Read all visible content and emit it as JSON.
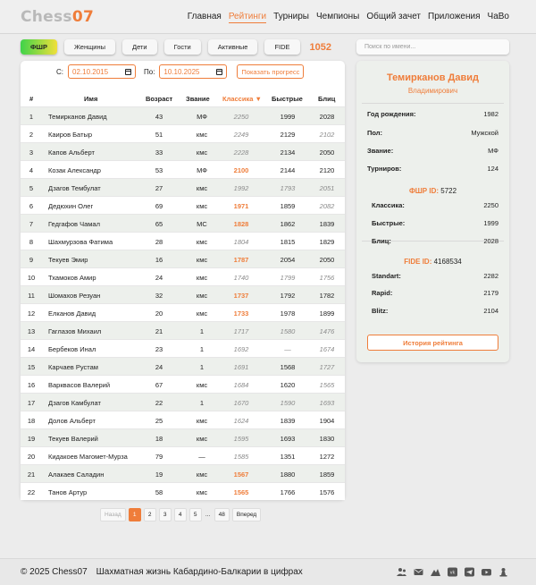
{
  "logo": {
    "part1": "Chess",
    "part2": "07"
  },
  "nav": [
    "Главная",
    "Рейтинги",
    "Турниры",
    "Чемпионы",
    "Общий зачет",
    "Приложения",
    "ЧаВо"
  ],
  "nav_active": 1,
  "filters": [
    "ФШР",
    "Женщины",
    "Дети",
    "Гости",
    "Активные",
    "FIDE"
  ],
  "filter_active": 0,
  "count": "1052",
  "search": {
    "placeholder": "Поиск по имени..."
  },
  "date_from_label": "С:",
  "date_from": "02.10.2015",
  "date_to_label": "По:",
  "date_to": "10.10.2025",
  "progress_label": "Показать прогресс",
  "columns": {
    "no": "#",
    "name": "Имя",
    "age": "Возраст",
    "title": "Звание",
    "classic": "Классика ▼",
    "blitz": "Быстрые",
    "bullet": "Блиц"
  },
  "rows": [
    {
      "no": "1",
      "name": "Темирканов Давид",
      "age": "43",
      "title": "МФ",
      "classic": "2250",
      "classic_style": "gray",
      "rapid": "1999",
      "rapid_style": "normal",
      "blitz": "2028",
      "blitz_style": "normal"
    },
    {
      "no": "2",
      "name": "Каиров Батыр",
      "age": "51",
      "title": "кмс",
      "classic": "2249",
      "classic_style": "gray",
      "rapid": "2129",
      "rapid_style": "normal",
      "blitz": "2102",
      "blitz_style": "gray"
    },
    {
      "no": "3",
      "name": "Капов Альберт",
      "age": "33",
      "title": "кмс",
      "classic": "2228",
      "classic_style": "gray",
      "rapid": "2134",
      "rapid_style": "normal",
      "blitz": "2050",
      "blitz_style": "normal"
    },
    {
      "no": "4",
      "name": "Козак Александр",
      "age": "53",
      "title": "МФ",
      "classic": "2100",
      "classic_style": "orange",
      "rapid": "2144",
      "rapid_style": "normal",
      "blitz": "2120",
      "blitz_style": "normal"
    },
    {
      "no": "5",
      "name": "Дзагов Тембулат",
      "age": "27",
      "title": "кмс",
      "classic": "1992",
      "classic_style": "gray",
      "rapid": "1793",
      "rapid_style": "gray",
      "blitz": "2051",
      "blitz_style": "gray"
    },
    {
      "no": "6",
      "name": "Дедюхин Олег",
      "age": "69",
      "title": "кмс",
      "classic": "1971",
      "classic_style": "orange",
      "rapid": "1859",
      "rapid_style": "normal",
      "blitz": "2082",
      "blitz_style": "gray"
    },
    {
      "no": "7",
      "name": "Гедгафов Чамал",
      "age": "65",
      "title": "МС",
      "classic": "1828",
      "classic_style": "orange",
      "rapid": "1862",
      "rapid_style": "normal",
      "blitz": "1839",
      "blitz_style": "normal"
    },
    {
      "no": "8",
      "name": "Шахмурзова Фатима",
      "age": "28",
      "title": "кмс",
      "classic": "1804",
      "classic_style": "gray",
      "rapid": "1815",
      "rapid_style": "normal",
      "blitz": "1829",
      "blitz_style": "normal"
    },
    {
      "no": "9",
      "name": "Текуев Эмир",
      "age": "16",
      "title": "кмс",
      "classic": "1787",
      "classic_style": "orange",
      "rapid": "2054",
      "rapid_style": "normal",
      "blitz": "2050",
      "blitz_style": "normal"
    },
    {
      "no": "10",
      "name": "Тхамоков Амир",
      "age": "24",
      "title": "кмс",
      "classic": "1740",
      "classic_style": "gray",
      "rapid": "1799",
      "rapid_style": "gray",
      "blitz": "1756",
      "blitz_style": "gray"
    },
    {
      "no": "11",
      "name": "Шомахов Резуан",
      "age": "32",
      "title": "кмс",
      "classic": "1737",
      "classic_style": "orange",
      "rapid": "1792",
      "rapid_style": "normal",
      "blitz": "1782",
      "blitz_style": "normal"
    },
    {
      "no": "12",
      "name": "Елканов Давид",
      "age": "20",
      "title": "кмс",
      "classic": "1733",
      "classic_style": "orange",
      "rapid": "1978",
      "rapid_style": "normal",
      "blitz": "1899",
      "blitz_style": "normal"
    },
    {
      "no": "13",
      "name": "Гаглазов Михаил",
      "age": "21",
      "title": "1",
      "classic": "1717",
      "classic_style": "gray",
      "rapid": "1580",
      "rapid_style": "gray",
      "blitz": "1476",
      "blitz_style": "gray"
    },
    {
      "no": "14",
      "name": "Бербеков Инал",
      "age": "23",
      "title": "1",
      "classic": "1692",
      "classic_style": "gray",
      "rapid": "—",
      "rapid_style": "gray",
      "blitz": "1674",
      "blitz_style": "gray"
    },
    {
      "no": "15",
      "name": "Карчаев Рустам",
      "age": "24",
      "title": "1",
      "classic": "1691",
      "classic_style": "gray",
      "rapid": "1568",
      "rapid_style": "normal",
      "blitz": "1727",
      "blitz_style": "gray"
    },
    {
      "no": "16",
      "name": "Варквасов Валерий",
      "age": "67",
      "title": "кмс",
      "classic": "1684",
      "classic_style": "gray",
      "rapid": "1620",
      "rapid_style": "normal",
      "blitz": "1565",
      "blitz_style": "gray"
    },
    {
      "no": "17",
      "name": "Дзагов Камбулат",
      "age": "22",
      "title": "1",
      "classic": "1670",
      "classic_style": "gray",
      "rapid": "1590",
      "rapid_style": "gray",
      "blitz": "1693",
      "blitz_style": "gray"
    },
    {
      "no": "18",
      "name": "Долов Альберт",
      "age": "25",
      "title": "кмс",
      "classic": "1624",
      "classic_style": "gray",
      "rapid": "1839",
      "rapid_style": "normal",
      "blitz": "1904",
      "blitz_style": "normal"
    },
    {
      "no": "19",
      "name": "Текуев Валерий",
      "age": "18",
      "title": "кмс",
      "classic": "1595",
      "classic_style": "gray",
      "rapid": "1693",
      "rapid_style": "normal",
      "blitz": "1830",
      "blitz_style": "normal"
    },
    {
      "no": "20",
      "name": "Кидакоев Магомет-Мурза",
      "age": "79",
      "title": "—",
      "classic": "1585",
      "classic_style": "gray",
      "rapid": "1351",
      "rapid_style": "normal",
      "blitz": "1272",
      "blitz_style": "normal"
    },
    {
      "no": "21",
      "name": "Алакаев Саладин",
      "age": "19",
      "title": "кмс",
      "classic": "1567",
      "classic_style": "orange",
      "rapid": "1880",
      "rapid_style": "normal",
      "blitz": "1859",
      "blitz_style": "normal"
    },
    {
      "no": "22",
      "name": "Танов Артур",
      "age": "58",
      "title": "кмс",
      "classic": "1565",
      "classic_style": "orange",
      "rapid": "1766",
      "rapid_style": "normal",
      "blitz": "1576",
      "blitz_style": "normal"
    }
  ],
  "pagination": {
    "prev": "Назад",
    "pages": [
      "1",
      "2",
      "3",
      "4",
      "5"
    ],
    "dots": "...",
    "last": "48",
    "next": "Вперед",
    "current": "1"
  },
  "profile": {
    "name": "Темирканов Давид",
    "patronymic": "Владимирович",
    "fields": [
      {
        "label": "Год рождения:",
        "value": "1982"
      },
      {
        "label": "Пол:",
        "value": "Мужской"
      },
      {
        "label": "Звание:",
        "value": "МФ"
      },
      {
        "label": "Турниров:",
        "value": "124"
      }
    ],
    "fshr_label": "ФШР ID:",
    "fshr_id": "5722",
    "fshr_ratings": [
      {
        "label": "Классика:",
        "value": "2250"
      },
      {
        "label": "Быстрые:",
        "value": "1999"
      },
      {
        "label": "Блиц:",
        "value": "2028"
      }
    ],
    "fide_label": "FIDE ID:",
    "fide_id": "4168534",
    "fide_ratings": [
      {
        "label": "Standart:",
        "value": "2282"
      },
      {
        "label": "Rapid:",
        "value": "2179"
      },
      {
        "label": "Blitz:",
        "value": "2104"
      }
    ],
    "history_button": "История рейтинга"
  },
  "footer": {
    "copyright": "© 2025 Chess07",
    "tagline": "Шахматная жизнь Кабардино-Балкарии в цифрах"
  },
  "footer_icons": [
    "users-icon",
    "mail-icon",
    "mountains-icon",
    "vk-icon",
    "telegram-icon",
    "youtube-icon",
    "chess-pawn-icon"
  ],
  "colors": {
    "accent": "#ef7d3a",
    "row_alt": "#edf0ec"
  }
}
